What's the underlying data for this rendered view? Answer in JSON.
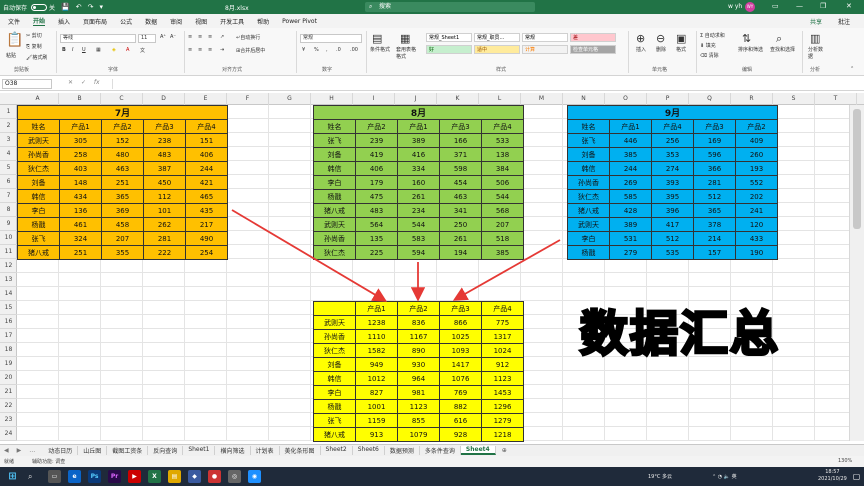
{
  "titlebar": {
    "autosave_label": "自动保存",
    "autosave_state": "关",
    "filename": "8月.xlsx",
    "search_placeholder": "搜索",
    "user": "w yh",
    "avatar": "WY"
  },
  "ribbon_tabs": [
    "文件",
    "开始",
    "插入",
    "页面布局",
    "公式",
    "数据",
    "审阅",
    "视图",
    "开发工具",
    "帮助",
    "Power Pivot"
  ],
  "ribbon_right": {
    "share": "共享",
    "comment": "批注"
  },
  "ribbon": {
    "paste_label": "粘贴",
    "cut": "剪切",
    "copy": "复制",
    "format_painter": "格式刷",
    "clipboard_group": "剪贴板",
    "font_name": "等线",
    "font_size": "11",
    "font_group": "字体",
    "wrap": "自动换行",
    "merge": "合并后居中",
    "align_group": "对齐方式",
    "number_format": "常规",
    "number_group": "数字",
    "cond_format": "条件格式",
    "table_format": "套用表格格式",
    "styles": [
      {
        "label": "常规_Sheet1",
        "bg": "#ffffff",
        "fg": "#000000"
      },
      {
        "label": "常规_职员...",
        "bg": "#ffffff",
        "fg": "#000000"
      },
      {
        "label": "常规",
        "bg": "#ffffff",
        "fg": "#000000"
      },
      {
        "label": "差",
        "bg": "#ffc7ce",
        "fg": "#9c0006"
      },
      {
        "label": "好",
        "bg": "#c6efce",
        "fg": "#006100"
      },
      {
        "label": "适中",
        "bg": "#ffeb9c",
        "fg": "#9c5700"
      },
      {
        "label": "计算",
        "bg": "#f2f2f2",
        "fg": "#fa7d00"
      },
      {
        "label": "检查单元格",
        "bg": "#a5a5a5",
        "fg": "#ffffff"
      }
    ],
    "styles_group": "样式",
    "insert": "插入",
    "delete": "删除",
    "format": "格式",
    "cells_group": "单元格",
    "autosum": "自动求和",
    "fill": "填充",
    "clear": "清除",
    "sort_filter": "排序和筛选",
    "find_select": "查找和选择",
    "edit_group": "编辑",
    "analyze": "分析数据",
    "analyze_group": "分析"
  },
  "formula_bar": {
    "name_box": "O38",
    "fx": "fx",
    "content": ""
  },
  "columns": [
    "A",
    "B",
    "C",
    "D",
    "E",
    "F",
    "G",
    "H",
    "I",
    "J",
    "K",
    "L",
    "M",
    "N",
    "O",
    "P",
    "Q",
    "R",
    "S",
    "T"
  ],
  "rows": [
    "1",
    "2",
    "3",
    "4",
    "5",
    "6",
    "7",
    "8",
    "9",
    "10",
    "11",
    "12",
    "13",
    "14",
    "15",
    "16",
    "17",
    "18",
    "19",
    "20",
    "21",
    "22",
    "23",
    "24",
    "25"
  ],
  "tables": {
    "july": {
      "title": "7月",
      "header": [
        "姓名",
        "产品1",
        "产品2",
        "产品3",
        "产品4"
      ],
      "rows": [
        [
          "武则天",
          "305",
          "152",
          "238",
          "151"
        ],
        [
          "孙尚香",
          "258",
          "480",
          "483",
          "406"
        ],
        [
          "狄仁杰",
          "403",
          "463",
          "387",
          "244"
        ],
        [
          "刘备",
          "148",
          "251",
          "450",
          "421"
        ],
        [
          "韩信",
          "434",
          "365",
          "112",
          "465"
        ],
        [
          "李白",
          "136",
          "369",
          "101",
          "435"
        ],
        [
          "杨戬",
          "461",
          "458",
          "262",
          "217"
        ],
        [
          "张飞",
          "324",
          "207",
          "281",
          "490"
        ],
        [
          "猪八戒",
          "251",
          "355",
          "222",
          "254"
        ]
      ],
      "color": "#ffc000"
    },
    "august": {
      "title": "8月",
      "header": [
        "姓名",
        "产品2",
        "产品1",
        "产品3",
        "产品4"
      ],
      "rows": [
        [
          "张飞",
          "239",
          "389",
          "166",
          "533"
        ],
        [
          "刘备",
          "419",
          "416",
          "371",
          "138"
        ],
        [
          "韩信",
          "406",
          "334",
          "598",
          "384"
        ],
        [
          "李白",
          "179",
          "160",
          "454",
          "506"
        ],
        [
          "杨戬",
          "475",
          "261",
          "463",
          "544"
        ],
        [
          "猪八戒",
          "483",
          "234",
          "341",
          "568"
        ],
        [
          "武则天",
          "564",
          "544",
          "250",
          "207"
        ],
        [
          "孙尚香",
          "135",
          "583",
          "261",
          "518"
        ],
        [
          "狄仁杰",
          "225",
          "594",
          "194",
          "385"
        ]
      ],
      "color": "#92d050"
    },
    "september": {
      "title": "9月",
      "header": [
        "姓名",
        "产品1",
        "产品4",
        "产品3",
        "产品2"
      ],
      "rows": [
        [
          "张飞",
          "446",
          "256",
          "169",
          "409"
        ],
        [
          "刘备",
          "385",
          "353",
          "596",
          "260"
        ],
        [
          "韩信",
          "244",
          "274",
          "366",
          "193"
        ],
        [
          "孙尚香",
          "269",
          "393",
          "281",
          "552"
        ],
        [
          "狄仁杰",
          "585",
          "395",
          "512",
          "202"
        ],
        [
          "猪八戒",
          "428",
          "396",
          "365",
          "241"
        ],
        [
          "武则天",
          "389",
          "417",
          "378",
          "120"
        ],
        [
          "李白",
          "531",
          "512",
          "214",
          "433"
        ],
        [
          "杨戬",
          "279",
          "535",
          "157",
          "190"
        ]
      ],
      "color": "#00b0f0"
    },
    "summary": {
      "header": [
        "",
        "产品1",
        "产品2",
        "产品3",
        "产品4"
      ],
      "rows": [
        [
          "武则天",
          "1238",
          "836",
          "866",
          "775"
        ],
        [
          "孙尚香",
          "1110",
          "1167",
          "1025",
          "1317"
        ],
        [
          "狄仁杰",
          "1582",
          "890",
          "1093",
          "1024"
        ],
        [
          "刘备",
          "949",
          "930",
          "1417",
          "912"
        ],
        [
          "韩信",
          "1012",
          "964",
          "1076",
          "1123"
        ],
        [
          "李白",
          "827",
          "981",
          "769",
          "1453"
        ],
        [
          "杨戬",
          "1001",
          "1123",
          "882",
          "1296"
        ],
        [
          "张飞",
          "1159",
          "855",
          "616",
          "1279"
        ],
        [
          "猪八戒",
          "913",
          "1079",
          "928",
          "1218"
        ]
      ],
      "color": "#ffff00"
    }
  },
  "overlay_text": "数据汇总",
  "sheet_tabs": [
    "动态日历",
    "山丘图",
    "截图工资条",
    "反向查询",
    "Sheet1",
    "横向筛选",
    "计划表",
    "美化条形图",
    "Sheet2",
    "Sheet6",
    "数据预测",
    "多条件查询",
    "Sheet4"
  ],
  "active_sheet": "Sheet4",
  "status": {
    "ready": "就绪",
    "accessibility": "辅助功能: 调查",
    "zoom": "130%"
  },
  "taskbar": {
    "weather": "19°C 多云",
    "lang": "英",
    "time": "18:57",
    "date": "2021/10/29"
  }
}
